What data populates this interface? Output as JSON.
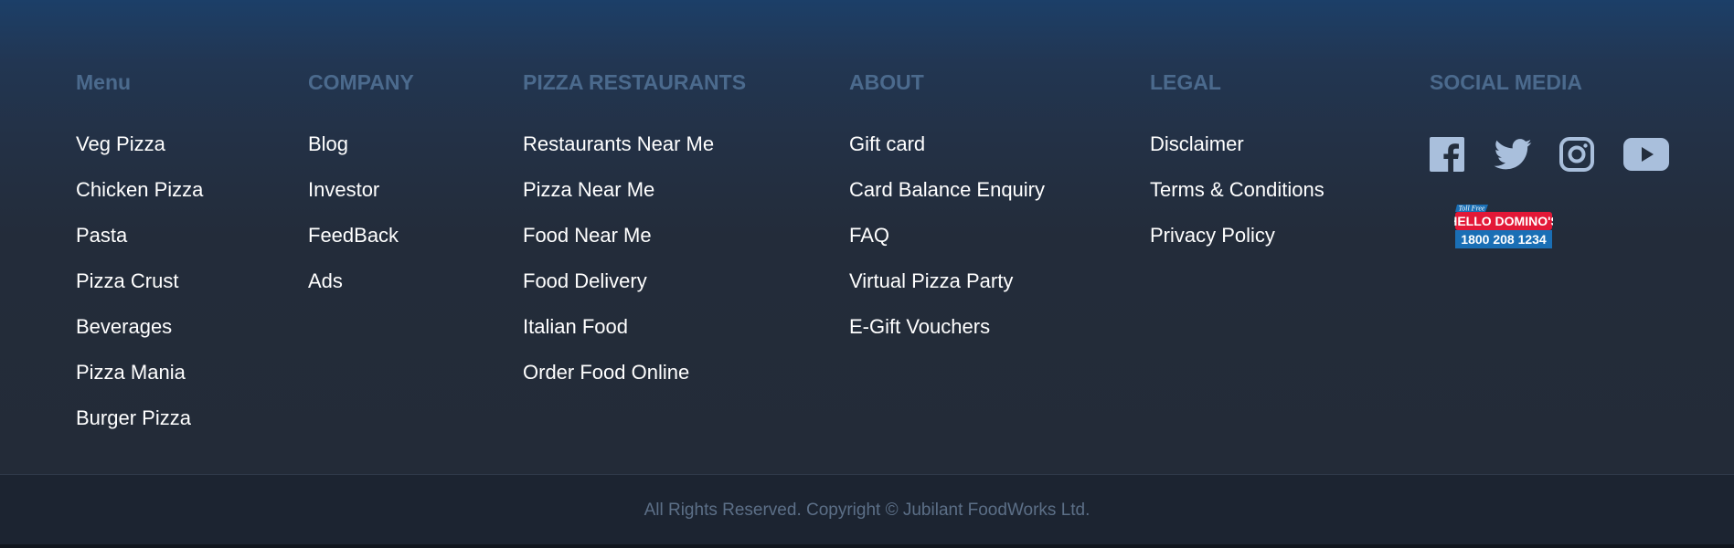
{
  "columns": [
    {
      "heading": "Menu",
      "items": [
        "Veg Pizza",
        "Chicken Pizza",
        "Pasta",
        "Pizza Crust",
        "Beverages",
        "Pizza Mania",
        "Burger Pizza"
      ]
    },
    {
      "heading": "COMPANY",
      "items": [
        "Blog",
        "Investor",
        "FeedBack",
        "Ads"
      ]
    },
    {
      "heading": "PIZZA RESTAURANTS",
      "items": [
        "Restaurants Near Me",
        "Pizza Near Me",
        "Food Near Me",
        "Food Delivery",
        "Italian Food",
        "Order Food Online"
      ]
    },
    {
      "heading": "ABOUT",
      "items": [
        "Gift card",
        "Card Balance Enquiry",
        "FAQ",
        "Virtual Pizza Party",
        "E-Gift Vouchers"
      ]
    },
    {
      "heading": "LEGAL",
      "items": [
        "Disclaimer",
        "Terms & Conditions",
        "Privacy Policy"
      ]
    }
  ],
  "social": {
    "heading": "SOCIAL MEDIA",
    "icons": [
      "facebook-icon",
      "twitter-icon",
      "instagram-icon",
      "youtube-icon"
    ],
    "icon_color": "#a9bfdc",
    "helpline": {
      "top": "Toll Free",
      "title": "HELLO DOMINO'S",
      "number": "1800 208 1234"
    }
  },
  "copyright": "All Rights Reserved. Copyright © Jubilant FoodWorks Ltd.",
  "colors": {
    "heading": "#4b6a8d",
    "link": "#ffffff",
    "copyright": "#5c6f87"
  }
}
